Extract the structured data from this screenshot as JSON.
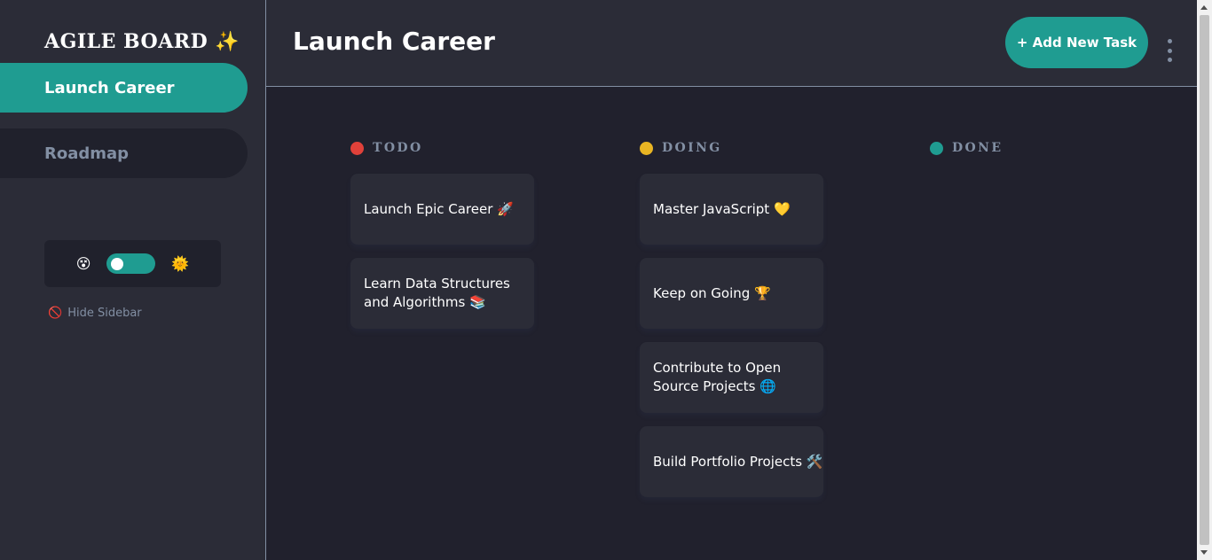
{
  "sidebar": {
    "logo": "AGILE BOARD ✨",
    "boards": [
      {
        "label": "Launch Career",
        "active": true
      },
      {
        "label": "Roadmap",
        "active": false
      }
    ],
    "theme": {
      "dark_icon": "😵",
      "light_icon": "🌞"
    },
    "hide_sidebar": {
      "icon": "🚫",
      "label": "Hide Sidebar"
    }
  },
  "header": {
    "title": "Launch Career",
    "add_task_label": "+ Add New Task",
    "menu_icon": "kebab-menu-icon"
  },
  "columns": [
    {
      "name": "TODO",
      "color": "#e0413a",
      "tasks": [
        {
          "title": "Launch Epic Career 🚀"
        },
        {
          "title": "Learn Data Structures and Algorithms 📚"
        }
      ]
    },
    {
      "name": "DOING",
      "color": "#e9b523",
      "tasks": [
        {
          "title": "Master JavaScript 💛"
        },
        {
          "title": "Keep on Going 🏆"
        },
        {
          "title": "Contribute to Open Source Projects 🌐"
        },
        {
          "title": "Build Portfolio Projects 🛠️"
        }
      ]
    },
    {
      "name": "DONE",
      "color": "#1f9c91",
      "tasks": []
    }
  ],
  "colors": {
    "accent": "#1f9c91",
    "background": "#21212d",
    "panel": "#2b2c37",
    "muted_text": "#828fa3"
  }
}
